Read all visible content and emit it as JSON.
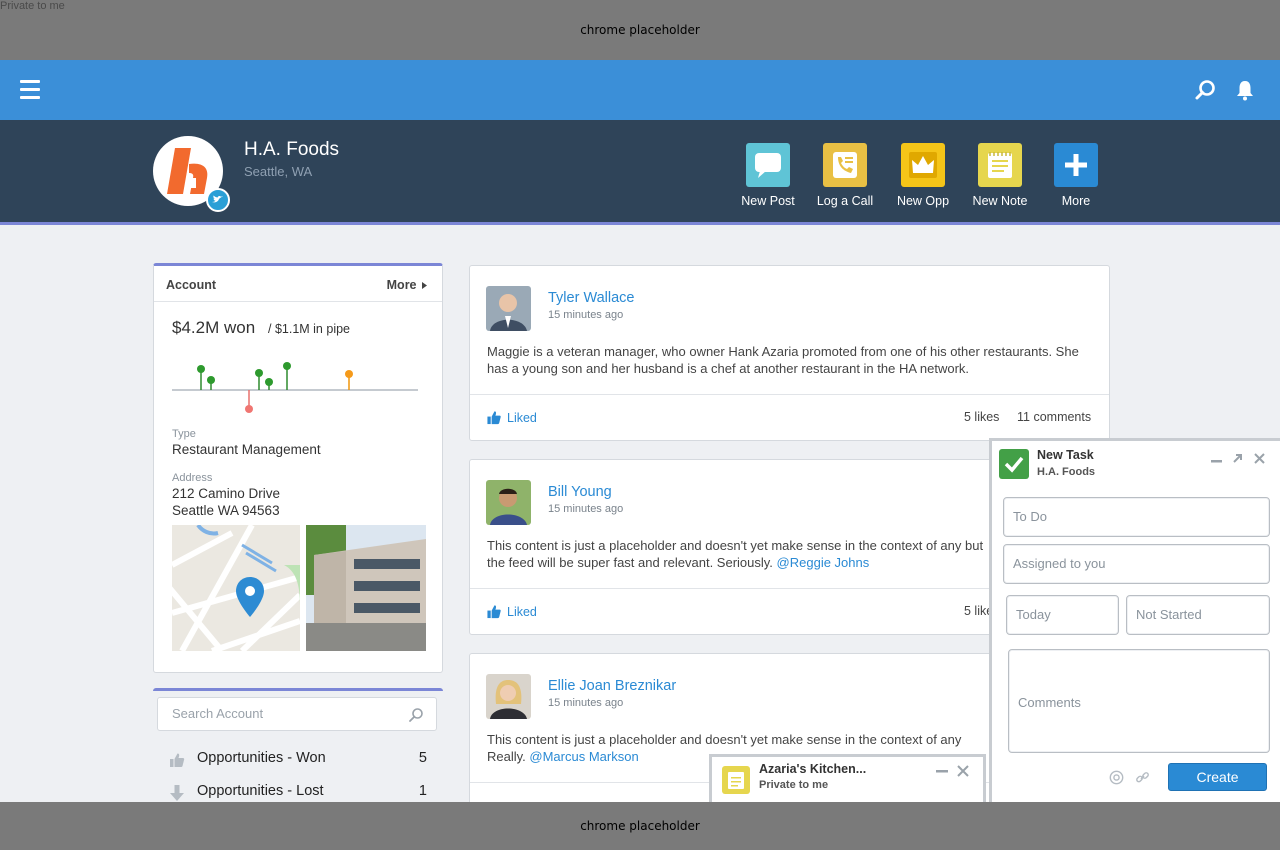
{
  "chrome": {
    "top_label": "chrome placeholder",
    "bottom_label": "chrome placeholder",
    "corner_label": "Private to me"
  },
  "header": {
    "company_name": "H.A. Foods",
    "location": "Seattle, WA",
    "actions": [
      {
        "label": "New Post",
        "icon": "chat-bubble-icon",
        "color": "#5fc4d6"
      },
      {
        "label": "Log a Call",
        "icon": "phone-icon",
        "color": "#e9c044"
      },
      {
        "label": "New Opp",
        "icon": "crown-icon",
        "color": "#f5c518"
      },
      {
        "label": "New Note",
        "icon": "note-icon",
        "color": "#e6d64e"
      },
      {
        "label": "More",
        "icon": "plus-icon",
        "color": "#2a8ad4"
      }
    ]
  },
  "account": {
    "title": "Account",
    "more_label": "More",
    "won": "$4.2M won",
    "pipe": "/ $1.1M in pipe",
    "type_label": "Type",
    "type_value": "Restaurant Management",
    "address_label": "Address",
    "address_line1": "212 Camino Drive",
    "address_line2": "Seattle WA 94563"
  },
  "search": {
    "placeholder": "Search Account"
  },
  "opportunities": [
    {
      "label": "Opportunities - Won",
      "count": "5",
      "icon": "thumbs-up-icon"
    },
    {
      "label": "Opportunities - Lost",
      "count": "1",
      "icon": "arrow-down-icon"
    }
  ],
  "feed": {
    "liked_label": "Liked",
    "posts": [
      {
        "author": "Tyler Wallace",
        "time": "15 minutes ago",
        "body": "Maggie is a veteran manager, who owner Hank Azaria promoted from one of his other restaurants. She has a young son and her husband is a chef at another restaurant in the HA network.",
        "mention": "",
        "likes": "5 likes",
        "comments": "11 comments"
      },
      {
        "author": "Bill Young",
        "time": "15 minutes ago",
        "body": "This content is just a placeholder and doesn't yet make sense in the context of any but the feed will be super fast and relevant.  Seriously.",
        "mention": "@Reggie Johns",
        "likes": "5 like"
      },
      {
        "author": "Ellie Joan Breznikar",
        "time": "15 minutes ago",
        "body": "This content is just a placeholder and doesn't yet make sense in the context of any Really.",
        "mention": "@Marcus Markson"
      }
    ]
  },
  "task": {
    "title": "New Task",
    "subtitle": "H.A. Foods",
    "todo_placeholder": "To Do",
    "assigned_placeholder": "Assigned to you",
    "date_placeholder": "Today",
    "status_placeholder": "Not Started",
    "comments_placeholder": "Comments",
    "create_label": "Create"
  },
  "note": {
    "title": "Azaria's Kitchen...",
    "subtitle": "Private to me"
  },
  "colors": {
    "topbar": "#3b8fd8",
    "header": "#2f4459",
    "accent": "#2a8ad4",
    "accent_border": "#7b86d6"
  }
}
